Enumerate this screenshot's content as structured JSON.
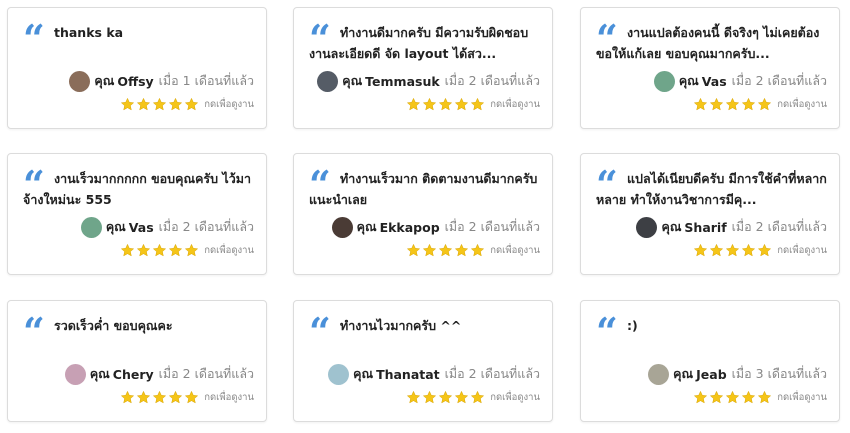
{
  "colors": {
    "accent": "#4a90d9",
    "star": "#f5c518",
    "muted": "#888888"
  },
  "icons": {
    "quote": "quote-icon",
    "star": "star-icon"
  },
  "reviews": [
    {
      "text": "thanks ka",
      "prefix": "คุณ",
      "username": "Offsy",
      "time": "เมื่อ 1 เดือนที่แล้ว",
      "rating": 5,
      "link": "กดเพื่อดูงาน",
      "avatar_color": "#8a6d5a"
    },
    {
      "text": "ทำงานดีมากครับ มีความรับผิดชอบงานละเอียดดี จัด layout ได้สว...",
      "prefix": "คุณ",
      "username": "Temmasuk",
      "time": "เมื่อ 2 เดือนที่แล้ว",
      "rating": 5,
      "link": "กดเพื่อดูงาน",
      "avatar_color": "#555c66"
    },
    {
      "text": "งานแปลต้องคนนี้ ดีจริงๆ ไม่เคยต้องขอให้แก้เลย ขอบคุณมากครับ...",
      "prefix": "คุณ",
      "username": "Vas",
      "time": "เมื่อ 2 เดือนที่แล้ว",
      "rating": 5,
      "link": "กดเพื่อดูงาน",
      "avatar_color": "#6fa58a"
    },
    {
      "text": "งานเร็วมากกกกก ขอบคุณครับ ไว้มาจ้างใหม่นะ 555",
      "prefix": "คุณ",
      "username": "Vas",
      "time": "เมื่อ 2 เดือนที่แล้ว",
      "rating": 5,
      "link": "กดเพื่อดูงาน",
      "avatar_color": "#6fa58a"
    },
    {
      "text": "ทำงานเร็วมาก ติดตามงานดีมากครับ แนะนำเลย",
      "prefix": "คุณ",
      "username": "Ekkapop",
      "time": "เมื่อ 2 เดือนที่แล้ว",
      "rating": 5,
      "link": "กดเพื่อดูงาน",
      "avatar_color": "#4a3b35"
    },
    {
      "text": "แปลได้เนียบดีครับ มีการใช้คำที่หลากหลาย ทำให้งานวิชาการมีคุ...",
      "prefix": "คุณ",
      "username": "Sharif",
      "time": "เมื่อ 2 เดือนที่แล้ว",
      "rating": 5,
      "link": "กดเพื่อดูงาน",
      "avatar_color": "#3d3f44"
    },
    {
      "text": "รวดเร็วค่ำ ขอบคุณคะ",
      "prefix": "คุณ",
      "username": "Chery",
      "time": "เมื่อ 2 เดือนที่แล้ว",
      "rating": 5,
      "link": "กดเพื่อดูงาน",
      "avatar_color": "#c7a0b4"
    },
    {
      "text": "ทำงานไวมากครับ ^^",
      "prefix": "คุณ",
      "username": "Thanatat",
      "time": "เมื่อ 2 เดือนที่แล้ว",
      "rating": 5,
      "link": "กดเพื่อดูงาน",
      "avatar_color": "#9fc2cf"
    },
    {
      "text": ":)",
      "prefix": "คุณ",
      "username": "Jeab",
      "time": "เมื่อ 3 เดือนที่แล้ว",
      "rating": 5,
      "link": "กดเพื่อดูงาน",
      "avatar_color": "#a8a596"
    }
  ]
}
